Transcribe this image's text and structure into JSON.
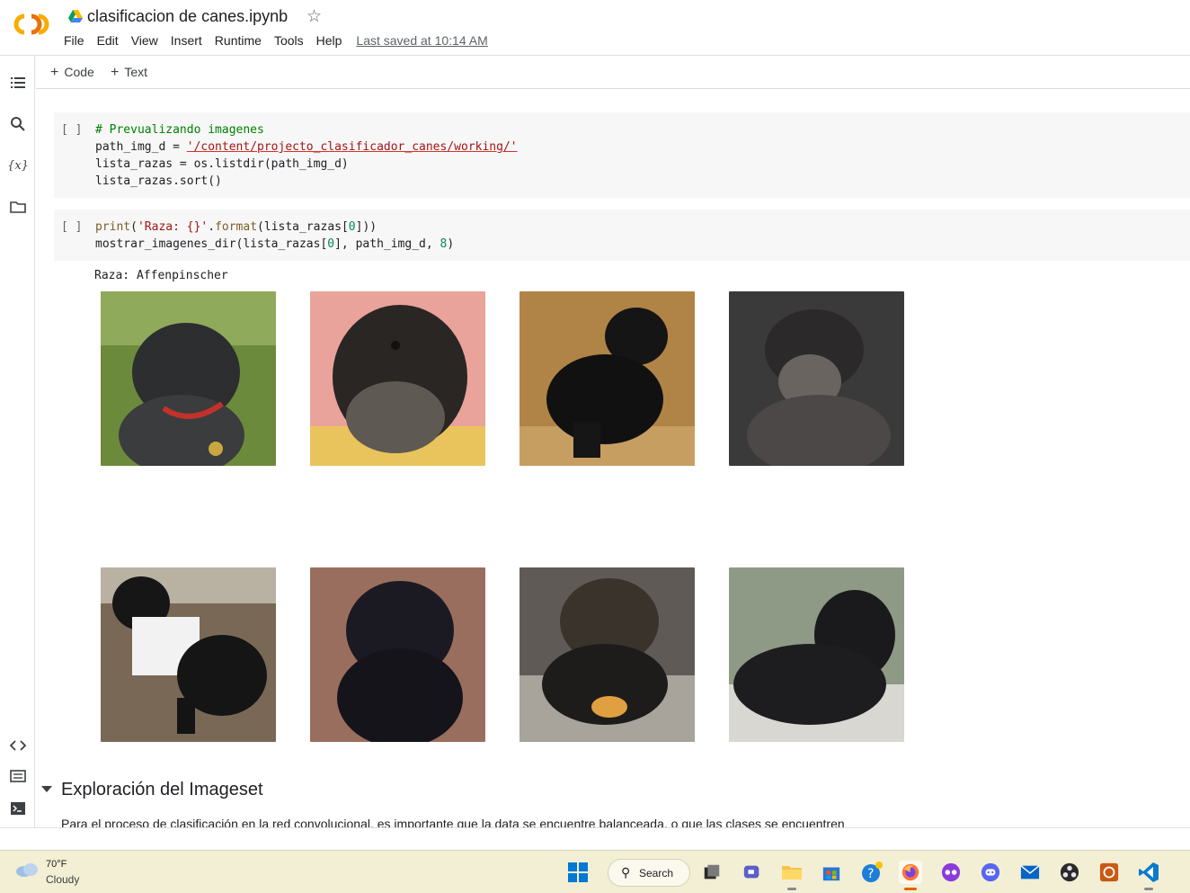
{
  "header": {
    "title": "clasificacion de canes.ipynb",
    "menu": [
      "File",
      "Edit",
      "View",
      "Insert",
      "Runtime",
      "Tools",
      "Help"
    ],
    "last_saved": "Last saved at 10:14 AM"
  },
  "toolbar": {
    "code_label": "Code",
    "text_label": "Text"
  },
  "cells": [
    {
      "run_indicator": "[ ]",
      "lines": [
        "# Prevualizando imagenes",
        "path_img_d = '/content/projecto_clasificador_canes/working/'",
        "lista_razas = os.listdir(path_img_d)",
        "lista_razas.sort()"
      ]
    },
    {
      "run_indicator": "[ ]",
      "lines": [
        "print('Raza: {}'.format(lista_razas[0]))",
        "mostrar_imagenes_dir(lista_razas[0], path_img_d, 8)"
      ],
      "output": "Raza: Affenpinscher"
    }
  ],
  "section": {
    "title": "Exploración del Imageset",
    "paragraph": "Para el proceso de clasificación en la red convolucional, es importante que la data se encuentre balanceada, o que las clases se encuentren"
  },
  "taskbar": {
    "temperature": "70°F",
    "condition": "Cloudy",
    "search_label": "Search"
  },
  "colors": {
    "colab_orange": "#f9ab00",
    "taskbar_bg": "#f3efd4",
    "cell_bg": "#f7f7f7"
  }
}
